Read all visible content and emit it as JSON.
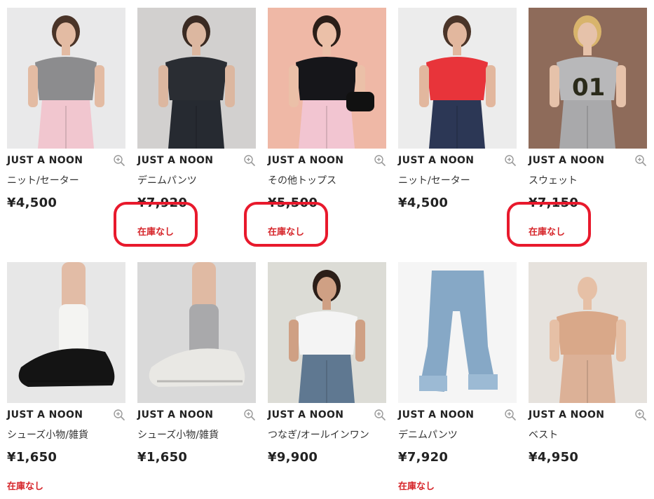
{
  "products": [
    {
      "brand": "JUST A NOON",
      "category": "ニット/セーター",
      "price": "¥4,500",
      "stock": "",
      "bg": "#e9e9ea",
      "top": "#8c8c8e",
      "bottom": "#f1c6cf",
      "skin": "#e3bba3",
      "hair": "#4a3428"
    },
    {
      "brand": "JUST A NOON",
      "category": "デニムパンツ",
      "price": "¥7,920",
      "stock": "在庫なし",
      "bg": "#d2d0cf",
      "top": "#2a2d33",
      "bottom": "#262a31",
      "skin": "#dcb7a0",
      "hair": "#3a2a22"
    },
    {
      "brand": "JUST A NOON",
      "category": "その他トップス",
      "price": "¥5,500",
      "stock": "在庫なし",
      "bg": "#efb8a6",
      "top": "#16161a",
      "bottom": "#f2c5d1",
      "skin": "#ebc0a8",
      "hair": "#2b1e18"
    },
    {
      "brand": "JUST A NOON",
      "category": "ニット/セーター",
      "price": "¥4,500",
      "stock": "",
      "bg": "#ececec",
      "top": "#e8343a",
      "bottom": "#2c3755",
      "skin": "#e2b79e",
      "hair": "#4a3428"
    },
    {
      "brand": "JUST A NOON",
      "category": "スウェット",
      "price": "¥7,150",
      "stock": "在庫なし",
      "bg": "#8e6b5a",
      "top": "#b8b8ba",
      "bottom": "#a9a9ab",
      "skin": "#e6c2aa",
      "hair": "#d8b46c"
    },
    {
      "brand": "JUST A NOON",
      "category": "シューズ小物/雑貨",
      "price": "¥1,650",
      "stock": "在庫なし",
      "bg": "#e7e7e7",
      "top": "#f4f4f2",
      "bottom": "#141414",
      "skin": "#e2bca6",
      "hair": "#e7e7e7"
    },
    {
      "brand": "JUST A NOON",
      "category": "シューズ小物/雑貨",
      "price": "¥1,650",
      "stock": "",
      "bg": "#d9d9d9",
      "top": "#a9a9ab",
      "bottom": "#e9e8e4",
      "skin": "#e0baa3",
      "hair": "#d9d9d9"
    },
    {
      "brand": "JUST A NOON",
      "category": "つなぎ/オールインワン",
      "price": "¥9,900",
      "stock": "",
      "bg": "#dcdcd6",
      "top": "#f4f4f4",
      "bottom": "#5f7891",
      "skin": "#cfa084",
      "hair": "#2b1e18"
    },
    {
      "brand": "JUST A NOON",
      "category": "デニムパンツ",
      "price": "¥7,920",
      "stock": "在庫なし",
      "bg": "#f5f5f5",
      "top": "#f5f5f5",
      "bottom": "#86a8c6",
      "skin": "#f5f5f5",
      "hair": "#f5f5f5"
    },
    {
      "brand": "JUST A NOON",
      "category": "ベスト",
      "price": "¥4,950",
      "stock": "",
      "bg": "#e6e2dd",
      "top": "#d9a889",
      "bottom": "#dcb197",
      "skin": "#e6c0a6",
      "hair": "#e6e2dd"
    }
  ],
  "zoom_icon": "zoom-in-icon",
  "accent_color": "#d6262b",
  "annotation_color": "#e8192c"
}
